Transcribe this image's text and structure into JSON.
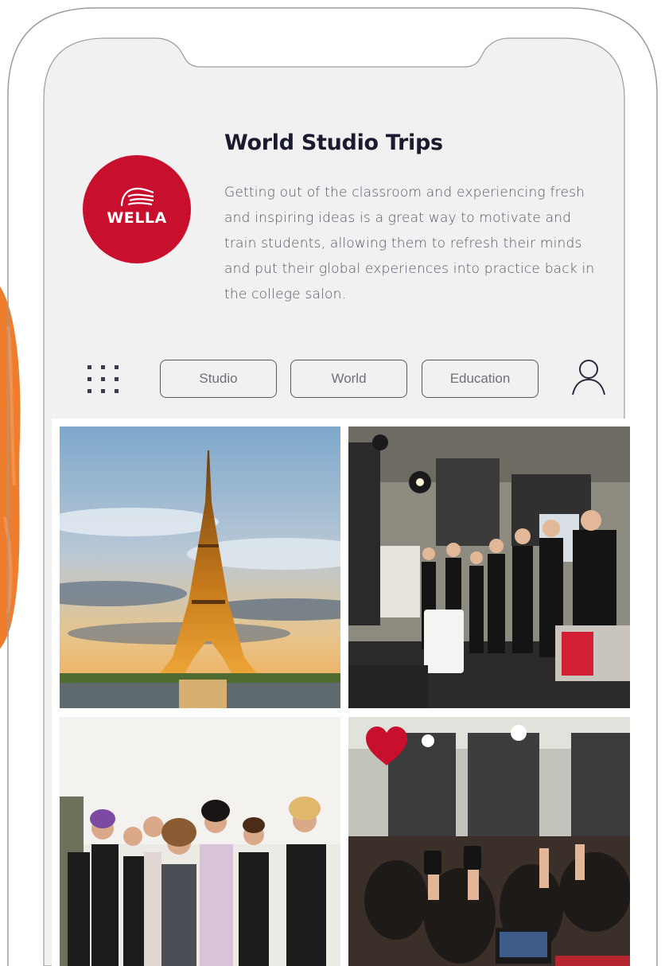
{
  "header": {
    "brand_logo_text": "WELLA",
    "title": "World Studio Trips",
    "description": "Getting out of the classroom and experiencing fresh and inspiring ideas is a great way to motivate and train students, allowing them to refresh their minds and put their global experiences into practice back in the college salon."
  },
  "toolbar": {
    "menu_icon": "grid-menu-icon",
    "tabs": [
      {
        "label": "Studio"
      },
      {
        "label": "World"
      },
      {
        "label": "Education"
      }
    ],
    "profile_icon": "user-profile-icon"
  },
  "gallery": {
    "photos": [
      {
        "subject": "eiffel-tower-photo"
      },
      {
        "subject": "stylists-on-stage-photo"
      },
      {
        "subject": "models-group-photo"
      },
      {
        "subject": "audience-filming-photo",
        "liked": true
      }
    ]
  },
  "colors": {
    "brand_red": "#c8102e",
    "screen_background": "#f1f1f1",
    "accent_orange": "#ee7d2d",
    "heart": "#c8102e"
  }
}
